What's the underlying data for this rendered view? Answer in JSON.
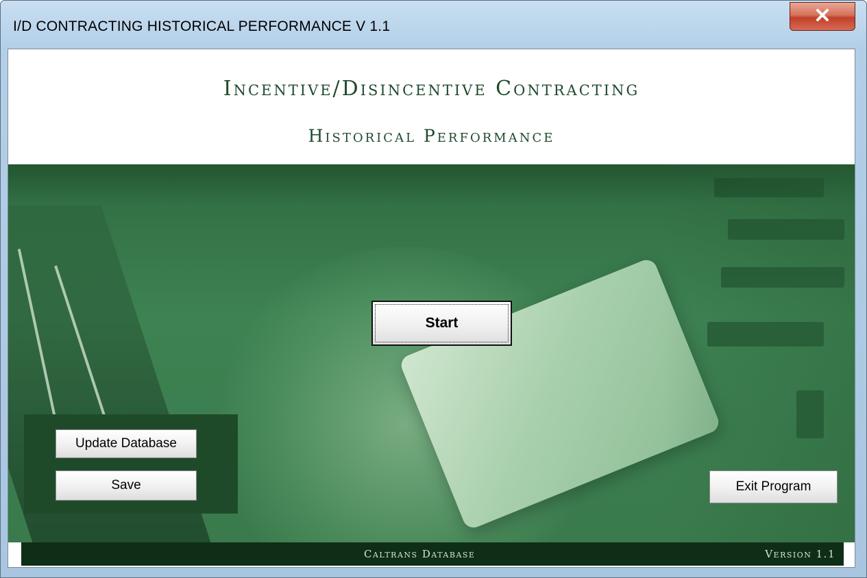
{
  "window": {
    "title": "I/D CONTRACTING HISTORICAL PERFORMANCE  V 1.1",
    "close_icon": "close-icon"
  },
  "header": {
    "line1": "Incentive/Disincentive Contracting",
    "line2": "Historical Performance"
  },
  "buttons": {
    "start": "Start",
    "update_database": "Update Database",
    "save": "Save",
    "exit_program": "Exit Program"
  },
  "footer": {
    "center": "Caltrans Database",
    "right": "Version 1.1"
  },
  "colors": {
    "heading": "#1f4b2c",
    "scene_green": "#3e8252",
    "footer_bg": "#0f2e17",
    "close_button": "#c2402a"
  }
}
